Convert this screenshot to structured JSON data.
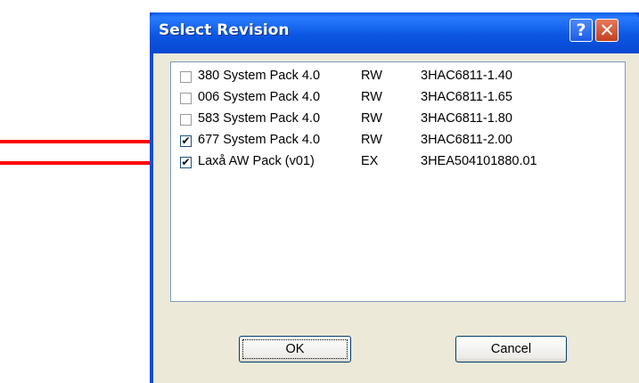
{
  "window": {
    "title": "Select Revision"
  },
  "titlebar_buttons": {
    "help": "?",
    "close": "✕"
  },
  "revisions": [
    {
      "checked": false,
      "name": "380 System Pack 4.0",
      "type": "RW",
      "part_number": "3HAC6811-1.40"
    },
    {
      "checked": false,
      "name": "006 System Pack 4.0",
      "type": "RW",
      "part_number": "3HAC6811-1.65"
    },
    {
      "checked": false,
      "name": "583 System Pack 4.0",
      "type": "RW",
      "part_number": "3HAC6811-1.80"
    },
    {
      "checked": true,
      "name": "677 System Pack 4.0",
      "type": "RW",
      "part_number": "3HAC6811-2.00"
    },
    {
      "checked": true,
      "name": "Laxå AW Pack (v01)",
      "type": "EX",
      "part_number": "3HEA504101880.01"
    }
  ],
  "buttons": {
    "ok": "OK",
    "cancel": "Cancel"
  },
  "colors": {
    "arrow": "#ff0000",
    "titlebar": "#0a5fe8",
    "dialog_body": "#ece9d8"
  }
}
